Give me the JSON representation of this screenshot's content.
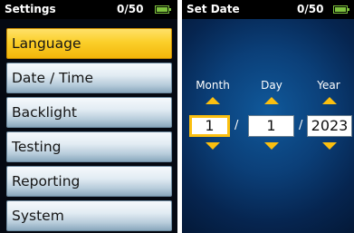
{
  "settings_screen": {
    "title": "Settings",
    "count": "0/50",
    "battery_level": 1.0,
    "menu_items": [
      {
        "label": "Language",
        "selected": true
      },
      {
        "label": "Date / Time",
        "selected": false
      },
      {
        "label": "Backlight",
        "selected": false
      },
      {
        "label": "Testing",
        "selected": false
      },
      {
        "label": "Reporting",
        "selected": false
      },
      {
        "label": "System",
        "selected": false
      }
    ]
  },
  "set_date_screen": {
    "title": "Set Date",
    "count": "0/50",
    "battery_level": 1.0,
    "separator": "/",
    "fields": [
      {
        "label": "Month",
        "value": "1",
        "active": true
      },
      {
        "label": "Day",
        "value": "1",
        "active": false
      },
      {
        "label": "Year",
        "value": "2023",
        "active": false
      }
    ]
  },
  "colors": {
    "accent_yellow": "#fbbf0f",
    "battery_green": "#7ec23e",
    "background_blue": "#0b3f78"
  }
}
